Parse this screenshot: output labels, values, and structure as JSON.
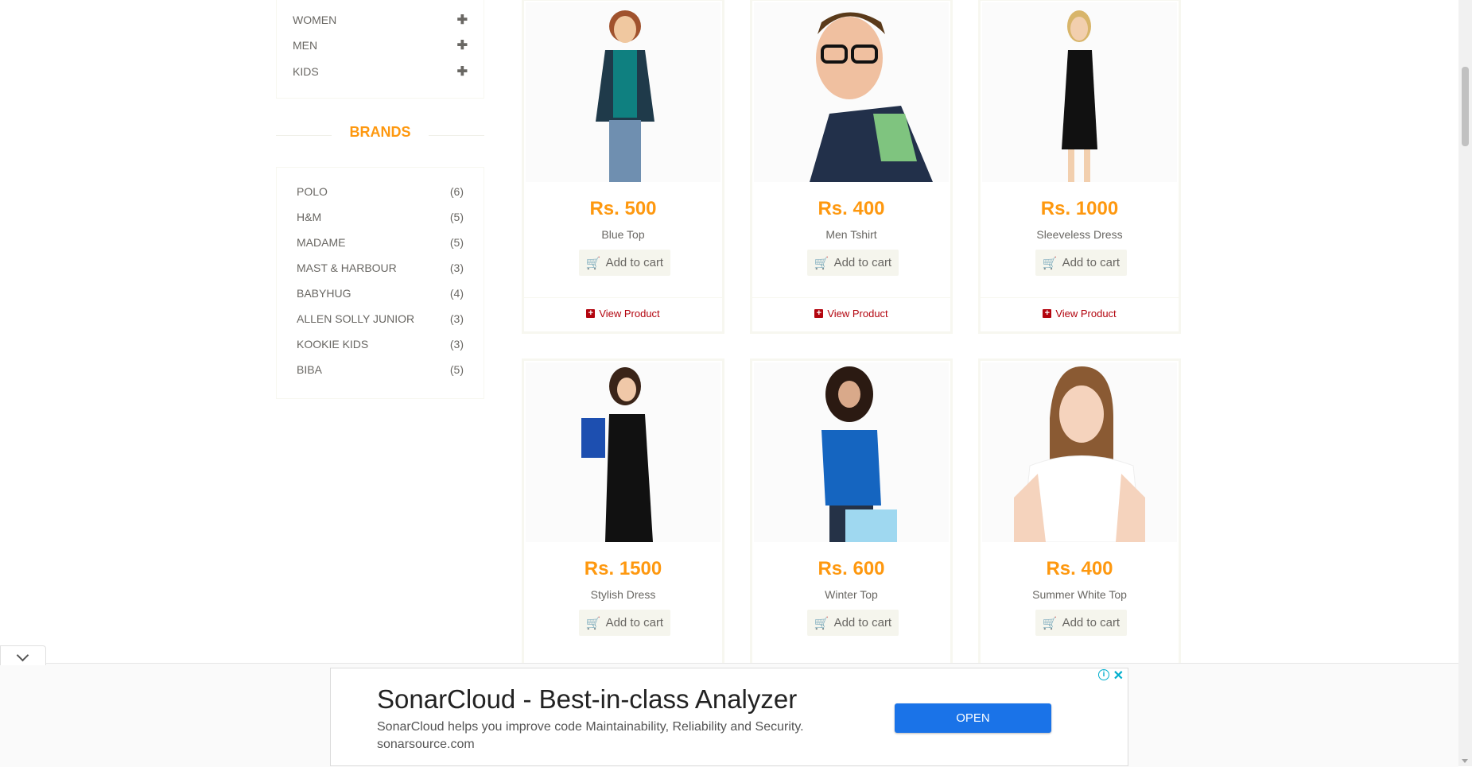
{
  "categories": [
    {
      "label": "WOMEN"
    },
    {
      "label": "MEN"
    },
    {
      "label": "KIDS"
    }
  ],
  "brands_title": "BRANDS",
  "brands": [
    {
      "name": "POLO",
      "count": "(6)"
    },
    {
      "name": "H&M",
      "count": "(5)"
    },
    {
      "name": "MADAME",
      "count": "(5)"
    },
    {
      "name": "MAST & HARBOUR",
      "count": "(3)"
    },
    {
      "name": "BABYHUG",
      "count": "(4)"
    },
    {
      "name": "ALLEN SOLLY JUNIOR",
      "count": "(3)"
    },
    {
      "name": "KOOKIE KIDS",
      "count": "(3)"
    },
    {
      "name": "BIBA",
      "count": "(5)"
    }
  ],
  "products": [
    {
      "price": "Rs. 500",
      "name": "Blue Top",
      "cart": "Add to cart",
      "view": "View Product"
    },
    {
      "price": "Rs. 400",
      "name": "Men Tshirt",
      "cart": "Add to cart",
      "view": "View Product"
    },
    {
      "price": "Rs. 1000",
      "name": "Sleeveless Dress",
      "cart": "Add to cart",
      "view": "View Product"
    },
    {
      "price": "Rs. 1500",
      "name": "Stylish Dress",
      "cart": "Add to cart"
    },
    {
      "price": "Rs. 600",
      "name": "Winter Top",
      "cart": "Add to cart"
    },
    {
      "price": "Rs. 400",
      "name": "Summer White Top",
      "cart": "Add to cart"
    }
  ],
  "ad": {
    "title": "SonarCloud - Best-in-class Analyzer",
    "description": "SonarCloud helps you improve code Maintainability, Reliability and Security.",
    "url": "sonarsource.com",
    "open_label": "OPEN"
  },
  "colors": {
    "accent": "#fe980f",
    "link": "#b3050f",
    "ad_button": "#1a73e8"
  }
}
